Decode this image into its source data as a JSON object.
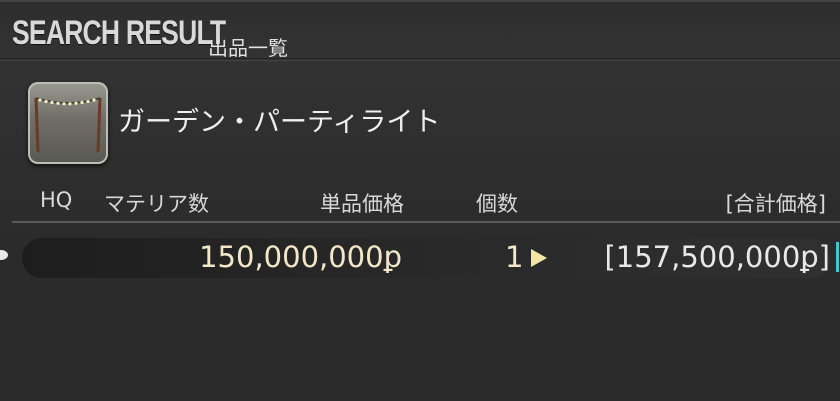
{
  "window": {
    "title": "SEARCH RESULT",
    "subtitle": "出品一覧"
  },
  "item": {
    "name": "ガーデン・パーティライト",
    "icon": "garden-party-light-icon"
  },
  "columns": {
    "hq": "HQ",
    "materia": "マテリア数",
    "unit_price": "単品価格",
    "quantity": "個数",
    "total_price": "[合計価格]"
  },
  "listings": [
    {
      "hq": "",
      "materia": "",
      "unit_price": "150,000,000ꝑ",
      "quantity": "1",
      "total_price": "[157,500,000ꝑ]"
    }
  ],
  "colors": {
    "price_text": "#f2e8c8",
    "arrow": "#f3e6a4",
    "cursor_accent": "#3ec8d0"
  }
}
